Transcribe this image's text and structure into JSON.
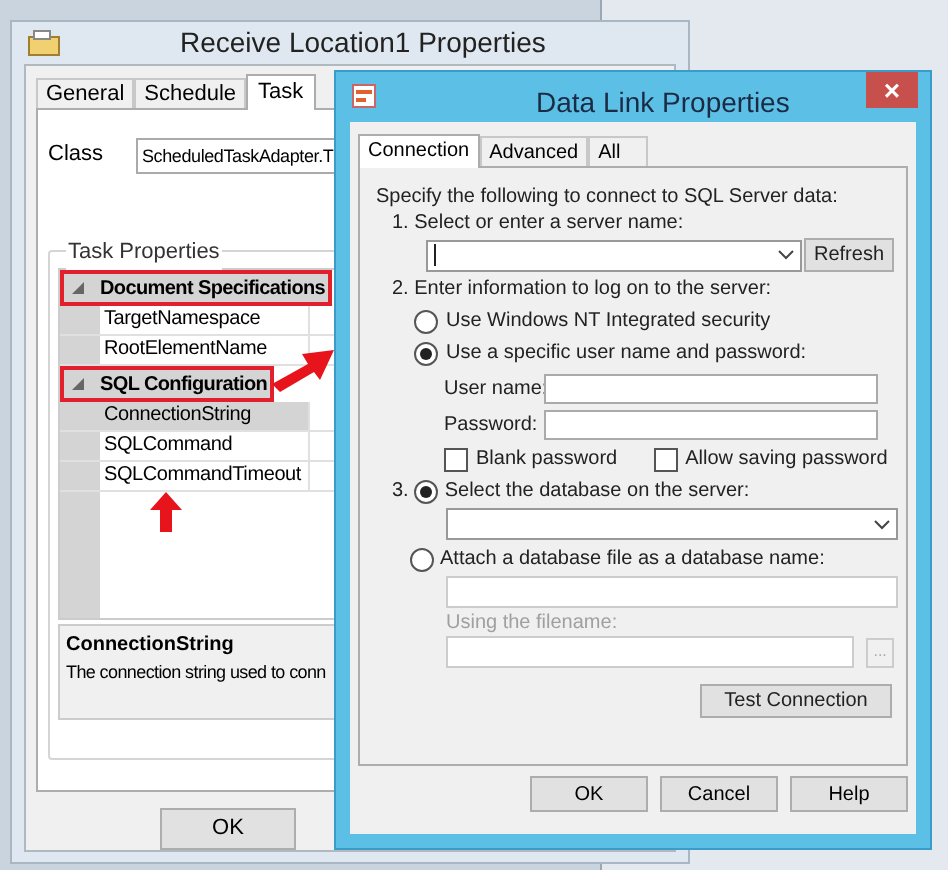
{
  "background_window": {
    "title": "Receive Location1 Properties",
    "tabs": [
      {
        "label": "General",
        "selected": false
      },
      {
        "label": "Schedule",
        "selected": false
      },
      {
        "label": "Task",
        "selected": true
      }
    ],
    "class_label": "Class",
    "class_value": "ScheduledTaskAdapter.T",
    "group_title": "Task Properties",
    "property_groups": [
      {
        "name": "Document Specifications",
        "expanded": true,
        "highlighted": true,
        "properties": [
          {
            "name": "TargetNamespace",
            "selected": false
          },
          {
            "name": "RootElementName",
            "selected": false
          }
        ]
      },
      {
        "name": "SQL Configuration",
        "expanded": true,
        "highlighted": true,
        "properties": [
          {
            "name": "ConnectionString",
            "selected": true
          },
          {
            "name": "SQLCommand",
            "selected": false
          },
          {
            "name": "SQLCommandTimeout",
            "selected": false
          }
        ]
      }
    ],
    "description": {
      "title": "ConnectionString",
      "text": "The connection string used to conn"
    },
    "buttons": [
      "OK"
    ]
  },
  "dialog": {
    "title": "Data Link Properties",
    "close": "×",
    "tabs": [
      {
        "label": "Connection",
        "selected": true
      },
      {
        "label": "Advanced",
        "selected": false
      },
      {
        "label": "All",
        "selected": false
      }
    ],
    "intro": "Specify the following to connect to SQL Server data:",
    "step1": "1. Select or enter a server name:",
    "refresh": "Refresh",
    "step2": "2. Enter information to log on to the server:",
    "auth_options": [
      {
        "label": "Use Windows NT Integrated security",
        "selected": false
      },
      {
        "label": "Use a specific user name and password:",
        "selected": true
      }
    ],
    "user_name_label": "User name:",
    "password_label": "Password:",
    "checkboxes": [
      {
        "label": "Blank password",
        "checked": false
      },
      {
        "label": "Allow saving password",
        "checked": false
      }
    ],
    "step3": "3.",
    "db_options": [
      {
        "label": "Select the database on the server:",
        "selected": true,
        "kind": "dropdown"
      },
      {
        "label": "Attach a database file as a database name:",
        "selected": false,
        "kind": "textbox"
      }
    ],
    "filename_label": "Using the filename:",
    "browse": "...",
    "test": "Test Connection",
    "buttons": [
      "OK",
      "Cancel",
      "Help"
    ]
  }
}
